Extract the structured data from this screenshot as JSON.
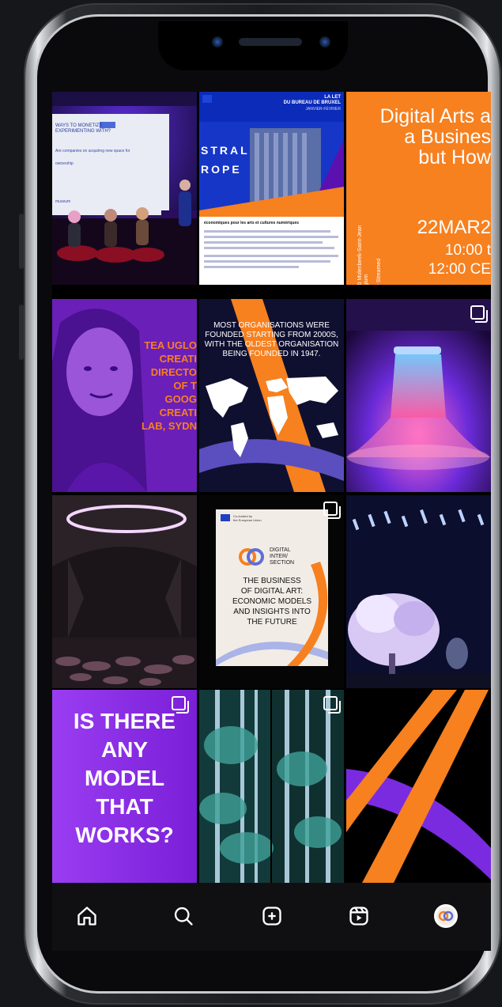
{
  "grid": {
    "tile1": {
      "slide_title": "WAYS TO MONETIZE\nEXPERIMENTING WITH?",
      "slide_line1": "Are companies on acquiring new space for",
      "slide_line2": "ownership",
      "slide_line3": "museum"
    },
    "tile2": {
      "header_right_1": "LA LET",
      "header_right_2": "DU BUREAU DE BRUXEL",
      "header_right_3": "JANVIER-FÉVRIER",
      "banner_1": "STRAL",
      "banner_2": "ROPE",
      "body_title": "économiques pour les arts et cultures numériques"
    },
    "tile3": {
      "title_line1": "Digital Arts a",
      "title_line2": "a Busines",
      "title_line3": "but How",
      "vertical_text": "1060 Molenbeek-Saint-Jean\nBelgium\n&\nLive Streamed",
      "date": "22MAR2",
      "time1": "10:00 t",
      "time2": "12:00 CE"
    },
    "tile4": {
      "lines": [
        "TEA UGLO",
        "CREATI",
        "DIRECTO",
        "OF T",
        "GOOG",
        "CREATI",
        "LAB, SYDN"
      ]
    },
    "tile5": {
      "lines": [
        "MOST ORGANISATIONS WERE",
        "FOUNDED STARTING FROM 2000S,",
        "WITH THE OLDEST ORGANISATION",
        "BEING FOUNDED IN 1947."
      ]
    },
    "tile8": {
      "eu_note": "Co-funded by\nthe European Union",
      "brand_line1": "DIGITAL",
      "brand_line2": "INTER/",
      "brand_line3": "SECTION",
      "title_lines": [
        "THE BUSINESS",
        "OF DIGITAL ART:",
        "ECONOMIC MODELS",
        "AND INSIGHTS INTO",
        "THE FUTURE"
      ]
    },
    "tile10": {
      "lines": [
        "IS THERE",
        "ANY",
        "MODEL",
        "THAT",
        "WORKS?"
      ]
    }
  },
  "nav": {
    "home": "home-icon",
    "search": "search-icon",
    "create": "plus-square-icon",
    "reels": "reels-icon",
    "profile": "profile-avatar"
  },
  "colors": {
    "orange": "#f7801f",
    "purple": "#8a2be2",
    "navy": "#0f1030",
    "background": "#15171b"
  }
}
